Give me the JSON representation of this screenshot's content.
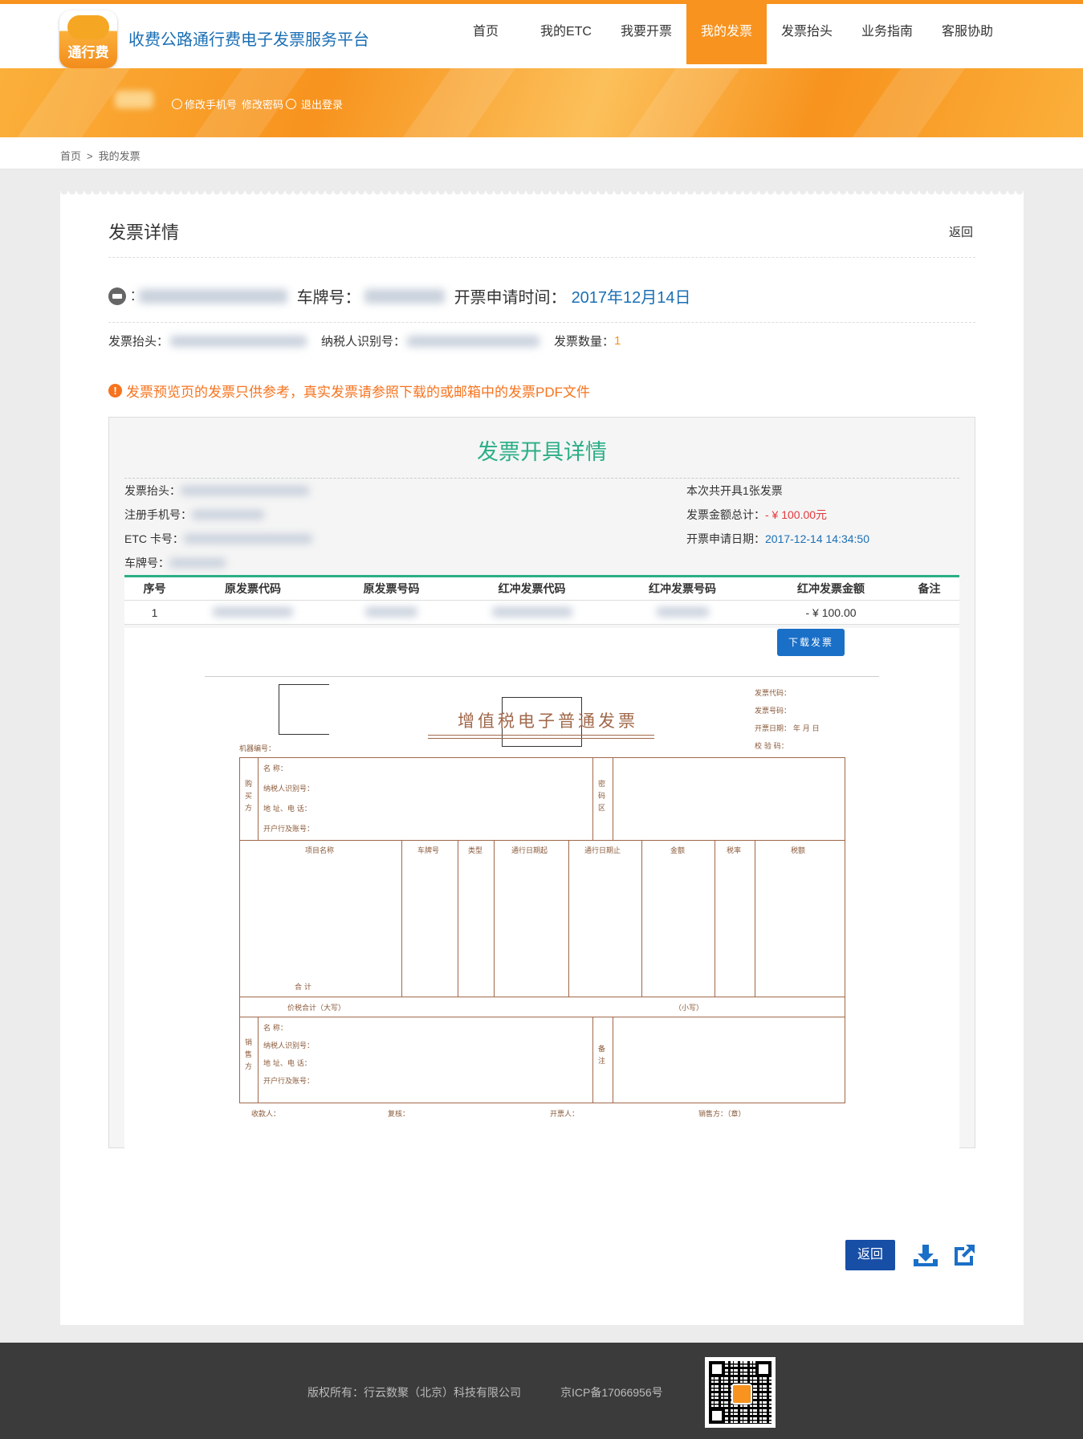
{
  "header": {
    "logo_text": "通行费",
    "site_title": "收费公路通行费电子发票服务平台",
    "nav": [
      "首页",
      "我的ETC",
      "我要开票",
      "我的发票",
      "发票抬头",
      "业务指南",
      "客服协助"
    ],
    "active_nav": "我的发票"
  },
  "banner": {
    "links": [
      "修改手机号",
      "修改密码",
      "退出登录"
    ]
  },
  "breadcrumb": {
    "home": "首页",
    "sep": ">",
    "current": "我的发票"
  },
  "detail": {
    "title": "发票详情",
    "back": "返回",
    "card_sep": ":",
    "plate_label": "车牌号：",
    "apply_time_label": "开票申请时间：",
    "apply_time": "2017年12月14日",
    "header_label": "发票抬头：",
    "taxid_label": "纳税人识别号：",
    "count_label": "发票数量：",
    "count": "1",
    "notice": "发票预览页的发票只供参考，真实发票请参照下载的或邮箱中的发票PDF文件"
  },
  "panel": {
    "title": "发票开具详情",
    "left": {
      "header_label": "发票抬头：",
      "phone_label": "注册手机号：",
      "etc_label": "ETC 卡号：",
      "plate_label": "车牌号："
    },
    "right": {
      "count_text": "本次共开具1张发票",
      "total_label": "发票金额总计：",
      "total": "- ¥ 100.00元",
      "date_label": "开票申请日期：",
      "date": "2017-12-14 14:34:50"
    },
    "table": {
      "headers": [
        "序号",
        "原发票代码",
        "原发票号码",
        "红冲发票代码",
        "红冲发票号码",
        "红冲发票金额",
        "备注"
      ],
      "rows": [
        {
          "no": "1",
          "amount": "- ¥ 100.00",
          "remark": ""
        }
      ]
    },
    "download_btn": "下载发票"
  },
  "invoice": {
    "title": "增值税电子普通发票",
    "code_label": "发票代码：",
    "number_label": "发票号码：",
    "date_label": "开票日期：  年  月  日",
    "check_label": "校 验 码：",
    "machine_label": "机器编号：",
    "buyer_side": "购买方",
    "buyer_fields": [
      "名      称：",
      "纳税人识别号：",
      "地 址、电 话：",
      "开户行及账号："
    ],
    "cipher": "密码区",
    "columns": [
      "项目名称",
      "车牌号",
      "类型",
      "通行日期起",
      "通行日期止",
      "金额",
      "税率",
      "税额"
    ],
    "total_label": "合      计",
    "total_words": "价税合计（大写）",
    "total_small": "（小写）",
    "seller_side": "销售方",
    "seller_fields": [
      "名      称：",
      "纳税人识别号：",
      "地 址、电 话：",
      "开户行及账号："
    ],
    "remark": "备注",
    "payee": "收款人：",
    "reviewer": "复核：",
    "drawer": "开票人：",
    "seller_seal": "销售方：（章）"
  },
  "actions": {
    "back": "返回"
  },
  "footer": {
    "copyright": "版权所有：行云数聚（北京）科技有限公司",
    "icp": "京ICP备17066956号"
  },
  "colors": {
    "accent": "#f7931e",
    "brand_blue": "#1a6fb5",
    "green": "#2bae86",
    "red": "#e4393c"
  },
  "icons": [
    "logo-icon",
    "user-icon",
    "card-icon",
    "warning-icon",
    "download-icon",
    "external-link-icon",
    "qr-code"
  ]
}
